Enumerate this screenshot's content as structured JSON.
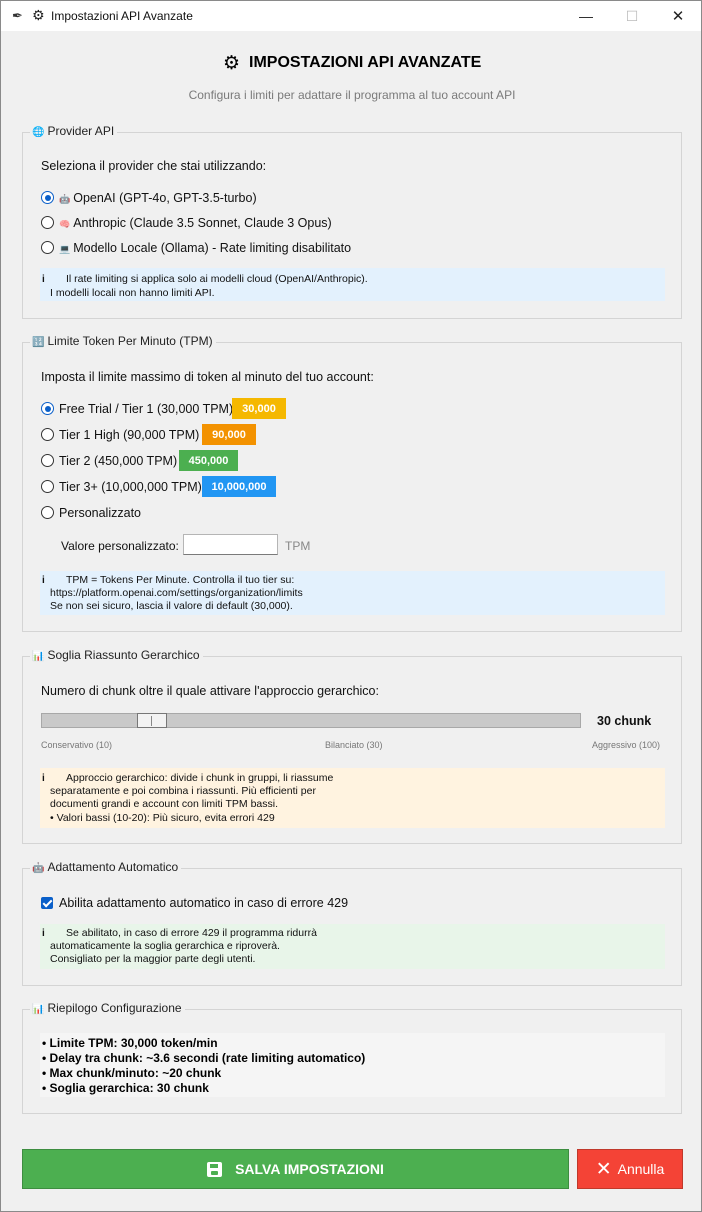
{
  "window": {
    "title": "Impostazioni API Avanzate",
    "controls": {
      "minimize": "—",
      "maximize": "☐",
      "close": "✕"
    }
  },
  "header": {
    "icon": "gear-icon",
    "title": "IMPOSTAZIONI API AVANZATE",
    "subtitle": "Configura i limiti per adattare il programma al tuo account API"
  },
  "provider": {
    "label": "Provider API",
    "prompt": "Seleziona il provider che stai utilizzando:",
    "options": [
      {
        "label": "OpenAI (GPT-4o, GPT-3.5-turbo)",
        "selected": true
      },
      {
        "label": "Anthropic (Claude 3.5 Sonnet, Claude 3 Opus)",
        "selected": false
      },
      {
        "label": "Modello Locale (Ollama) - Rate limiting disabilitato",
        "selected": false
      }
    ],
    "info": [
      "Il rate limiting si applica solo ai modelli cloud (OpenAI/Anthropic).",
      "I modelli locali non hanno limiti API."
    ]
  },
  "tpm": {
    "label": "Limite Token Per Minuto (TPM)",
    "prompt": "Imposta il limite massimo di token al minuto del tuo account:",
    "options": [
      {
        "label": "Free Trial / Tier 1 (30,000 TPM)",
        "badge": "30,000",
        "color": "#f5b800",
        "selected": true
      },
      {
        "label": "Tier 1 High (90,000 TPM)",
        "badge": "90,000",
        "color": "#f39200",
        "selected": false
      },
      {
        "label": "Tier 2 (450,000 TPM)",
        "badge": "450,000",
        "color": "#4caf50",
        "selected": false
      },
      {
        "label": "Tier 3+ (10,000,000 TPM)",
        "badge": "10,000,000",
        "color": "#2196f3",
        "selected": false
      },
      {
        "label": "Personalizzato",
        "selected": false
      }
    ],
    "custom_label": "Valore personalizzato:",
    "custom_value": "",
    "custom_unit": "TPM",
    "info": [
      "TPM = Tokens Per Minute. Controlla il tuo tier su:",
      "https://platform.openai.com/settings/organization/limits",
      "Se non sei sicuro, lascia il valore di default (30,000)."
    ]
  },
  "threshold": {
    "label": "Soglia Riassunto Gerarchico",
    "prompt": "Numero di chunk oltre il quale attivare l'approccio gerarchico:",
    "value_text": "30 chunk",
    "slider": {
      "min": 10,
      "max": 100,
      "value": 30
    },
    "ticks": [
      "Conservativo (10)",
      "Bilanciato (30)",
      "Aggressivo (100)"
    ],
    "info": [
      "Approccio gerarchico: divide i chunk in gruppi, li riassume",
      "separatamente e poi combina i riassunti. Più efficienti per",
      "documenti grandi e account con limiti TPM bassi.",
      "• Valori bassi (10-20): Più sicuro, evita errori 429"
    ]
  },
  "auto": {
    "label": "Adattamento Automatico",
    "checkbox_label": "Abilita adattamento automatico in caso di errore 429",
    "checked": true,
    "info": [
      "Se abilitato, in caso di errore 429 il programma ridurrà",
      "automaticamente la soglia gerarchica e riproverà.",
      "Consigliato per la maggior parte degli utenti."
    ]
  },
  "summary": {
    "label": "Riepilogo Configurazione",
    "lines": [
      "• Limite TPM: 30,000 token/min",
      "• Delay tra chunk: ~3.6 secondi (rate limiting automatico)",
      "• Max chunk/minuto: ~20 chunk",
      "• Soglia gerarchica: 30 chunk"
    ]
  },
  "buttons": {
    "save": "SALVA IMPOSTAZIONI",
    "cancel": "Annulla"
  },
  "colors": {
    "info_blue": "#e3f1fd",
    "info_orange": "#fff3e0",
    "info_green": "#e8f5e9",
    "summary_bg": "#f5f5f5",
    "save_green": "#4caf50",
    "cancel_red": "#f44336",
    "accent": "#0a5fc9"
  }
}
